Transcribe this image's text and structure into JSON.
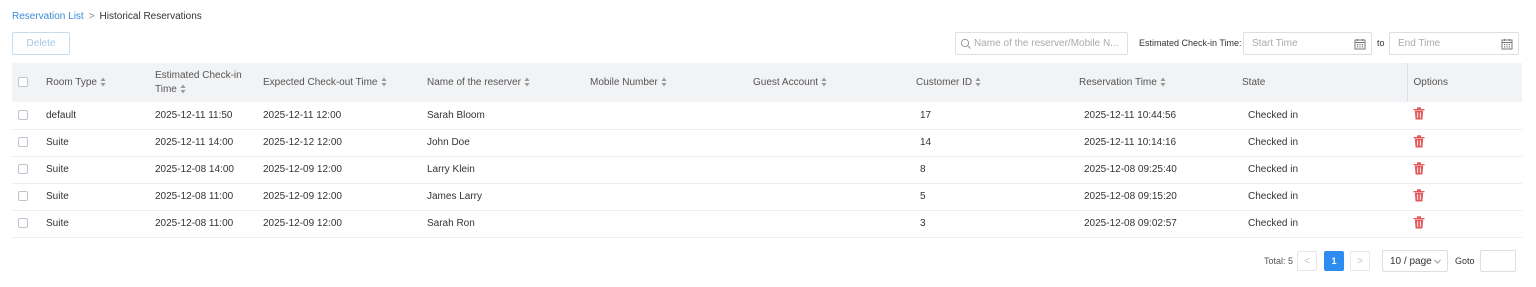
{
  "breadcrumb": {
    "parent": "Reservation List",
    "separator": ">",
    "current": "Historical Reservations"
  },
  "toolbar": {
    "delete_label": "Delete",
    "search_placeholder": "Name of the reserver/Mobile N...",
    "checkin_filter_label": "Estimated Check-in Time:",
    "start_placeholder": "Start Time",
    "to_label": "to",
    "end_placeholder": "End Time"
  },
  "table": {
    "headers": {
      "room_type": "Room Type",
      "checkin_line1": "Estimated Check-in",
      "checkin_line2": "Time",
      "checkout": "Expected Check-out Time",
      "reserver": "Name of the reserver",
      "mobile": "Mobile Number",
      "guest": "Guest Account",
      "customer_id": "Customer ID",
      "reservation_time": "Reservation Time",
      "state": "State",
      "options": "Options"
    },
    "rows": [
      {
        "room_type": "default",
        "checkin": "2025-12-11 11:50",
        "checkout": "2025-12-11 12:00",
        "reserver": "Sarah Bloom",
        "mobile": "",
        "guest": "",
        "customer_id": "17",
        "reservation_time": "2025-12-11 10:44:56",
        "state": "Checked in"
      },
      {
        "room_type": "Suite",
        "checkin": "2025-12-11 14:00",
        "checkout": "2025-12-12 12:00",
        "reserver": "John Doe",
        "mobile": "",
        "guest": "",
        "customer_id": "14",
        "reservation_time": "2025-12-11 10:14:16",
        "state": "Checked in"
      },
      {
        "room_type": "Suite",
        "checkin": "2025-12-08 14:00",
        "checkout": "2025-12-09 12:00",
        "reserver": "Larry Klein",
        "mobile": "",
        "guest": "",
        "customer_id": "8",
        "reservation_time": "2025-12-08 09:25:40",
        "state": "Checked in"
      },
      {
        "room_type": "Suite",
        "checkin": "2025-12-08 11:00",
        "checkout": "2025-12-09 12:00",
        "reserver": "James Larry",
        "mobile": "",
        "guest": "",
        "customer_id": "5",
        "reservation_time": "2025-12-08 09:15:20",
        "state": "Checked in"
      },
      {
        "room_type": "Suite",
        "checkin": "2025-12-08 11:00",
        "checkout": "2025-12-09 12:00",
        "reserver": "Sarah Ron",
        "mobile": "",
        "guest": "",
        "customer_id": "3",
        "reservation_time": "2025-12-08 09:02:57",
        "state": "Checked in"
      }
    ]
  },
  "pagination": {
    "total": "Total: 5",
    "prev": "<",
    "current_page": "1",
    "next": ">",
    "page_size": "10 / page",
    "goto_label": "Goto"
  },
  "colors": {
    "link": "#3b8bd6",
    "primary": "#2d8cf0",
    "delete_icon": "#e05a5a",
    "header_bg": "#f2f3f5"
  },
  "icons": {
    "search": "search-icon",
    "calendar": "calendar-icon",
    "sort": "sort-icon",
    "trash": "trash-icon",
    "chevron": "chevron-down-icon"
  }
}
